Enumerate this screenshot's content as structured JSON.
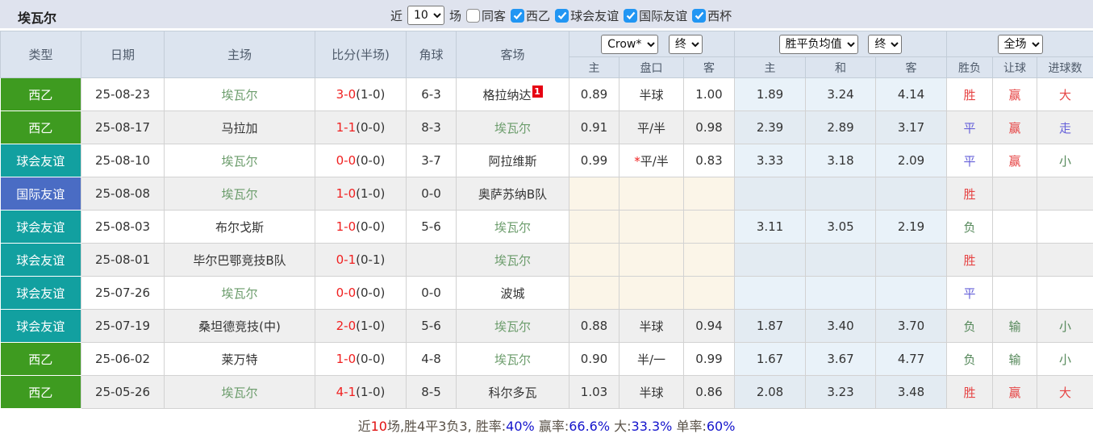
{
  "topbar": {
    "title": "埃瓦尔",
    "near_label": "近",
    "matches_select": {
      "value": "10"
    },
    "field_label": "场",
    "filters": [
      {
        "label": "同客",
        "checked": false
      },
      {
        "label": "西乙",
        "checked": true
      },
      {
        "label": "球会友谊",
        "checked": true
      },
      {
        "label": "国际友谊",
        "checked": true
      },
      {
        "label": "西杯",
        "checked": true
      }
    ]
  },
  "header": {
    "left_columns": [
      "类型",
      "日期",
      "主场",
      "比分(半场)",
      "角球",
      "客场"
    ],
    "dropdowns": {
      "bookmaker": "Crow*",
      "bookmaker_time": "终",
      "avg": "胜平负均值",
      "avg_time": "终",
      "scope": "全场"
    },
    "sub_columns": [
      "主",
      "盘口",
      "客",
      "主",
      "和",
      "客",
      "胜负",
      "让球",
      "进球数"
    ]
  },
  "colors": {
    "type": {
      "xiyi": "#3e9b20",
      "qiuhui": "#12a0a0",
      "guoji": "#4a6cc4"
    },
    "accent_checkbox": "#2196f3"
  },
  "rows": [
    {
      "type": "西乙",
      "type_key": "xiyi",
      "date": "25-08-23",
      "home": "埃瓦尔",
      "home_focus": true,
      "score": "3-0",
      "half": "(1-0)",
      "corner": "6-3",
      "away": "格拉纳达",
      "away_focus": false,
      "away_sup": "1",
      "crow_home": "0.89",
      "handicap_prefix": "",
      "handicap": "半球",
      "crow_away": "1.00",
      "avg_home": "1.89",
      "avg_draw": "3.24",
      "avg_away": "4.14",
      "result": "胜",
      "result_key": "red",
      "let_result": "赢",
      "let_key": "red",
      "goal_result": "大",
      "goal_key": "red"
    },
    {
      "type": "西乙",
      "type_key": "xiyi",
      "date": "25-08-17",
      "home": "马拉加",
      "home_focus": false,
      "score": "1-1",
      "half": "(0-0)",
      "corner": "8-3",
      "away": "埃瓦尔",
      "away_focus": true,
      "away_sup": "",
      "crow_home": "0.91",
      "handicap_prefix": "",
      "handicap": "平/半",
      "crow_away": "0.98",
      "avg_home": "2.39",
      "avg_draw": "2.89",
      "avg_away": "3.17",
      "result": "平",
      "result_key": "blue",
      "let_result": "赢",
      "let_key": "red",
      "goal_result": "走",
      "goal_key": "blue"
    },
    {
      "type": "球会友谊",
      "type_key": "qiuhui",
      "date": "25-08-10",
      "home": "埃瓦尔",
      "home_focus": true,
      "score": "0-0",
      "half": "(0-0)",
      "corner": "3-7",
      "away": "阿拉维斯",
      "away_focus": false,
      "away_sup": "",
      "crow_home": "0.99",
      "handicap_prefix": "*",
      "handicap": "平/半",
      "crow_away": "0.83",
      "avg_home": "3.33",
      "avg_draw": "3.18",
      "avg_away": "2.09",
      "result": "平",
      "result_key": "blue",
      "let_result": "赢",
      "let_key": "red",
      "goal_result": "小",
      "goal_key": "green"
    },
    {
      "type": "国际友谊",
      "type_key": "guoji",
      "date": "25-08-08",
      "home": "埃瓦尔",
      "home_focus": true,
      "score": "1-0",
      "half": "(1-0)",
      "corner": "0-0",
      "away": "奥萨苏纳B队",
      "away_focus": false,
      "away_sup": "",
      "crow_home": "",
      "handicap_prefix": "",
      "handicap": "",
      "crow_away": "",
      "avg_home": "",
      "avg_draw": "",
      "avg_away": "",
      "result": "胜",
      "result_key": "red",
      "let_result": "",
      "let_key": "",
      "goal_result": "",
      "goal_key": ""
    },
    {
      "type": "球会友谊",
      "type_key": "qiuhui",
      "date": "25-08-03",
      "home": "布尔戈斯",
      "home_focus": false,
      "score": "1-0",
      "half": "(0-0)",
      "corner": "5-6",
      "away": "埃瓦尔",
      "away_focus": true,
      "away_sup": "",
      "crow_home": "",
      "handicap_prefix": "",
      "handicap": "",
      "crow_away": "",
      "avg_home": "3.11",
      "avg_draw": "3.05",
      "avg_away": "2.19",
      "result": "负",
      "result_key": "green",
      "let_result": "",
      "let_key": "",
      "goal_result": "",
      "goal_key": ""
    },
    {
      "type": "球会友谊",
      "type_key": "qiuhui",
      "date": "25-08-01",
      "home": "毕尔巴鄂竞技B队",
      "home_focus": false,
      "score": "0-1",
      "half": "(0-1)",
      "corner": "",
      "away": "埃瓦尔",
      "away_focus": true,
      "away_sup": "",
      "crow_home": "",
      "handicap_prefix": "",
      "handicap": "",
      "crow_away": "",
      "avg_home": "",
      "avg_draw": "",
      "avg_away": "",
      "result": "胜",
      "result_key": "red",
      "let_result": "",
      "let_key": "",
      "goal_result": "",
      "goal_key": ""
    },
    {
      "type": "球会友谊",
      "type_key": "qiuhui",
      "date": "25-07-26",
      "home": "埃瓦尔",
      "home_focus": true,
      "score": "0-0",
      "half": "(0-0)",
      "corner": "0-0",
      "away": "波城",
      "away_focus": false,
      "away_sup": "",
      "crow_home": "",
      "handicap_prefix": "",
      "handicap": "",
      "crow_away": "",
      "avg_home": "",
      "avg_draw": "",
      "avg_away": "",
      "result": "平",
      "result_key": "blue",
      "let_result": "",
      "let_key": "",
      "goal_result": "",
      "goal_key": ""
    },
    {
      "type": "球会友谊",
      "type_key": "qiuhui",
      "date": "25-07-19",
      "home": "桑坦德竞技(中)",
      "home_focus": false,
      "score": "2-0",
      "half": "(1-0)",
      "corner": "5-6",
      "away": "埃瓦尔",
      "away_focus": true,
      "away_sup": "",
      "crow_home": "0.88",
      "handicap_prefix": "",
      "handicap": "半球",
      "crow_away": "0.94",
      "avg_home": "1.87",
      "avg_draw": "3.40",
      "avg_away": "3.70",
      "result": "负",
      "result_key": "green",
      "let_result": "输",
      "let_key": "green",
      "goal_result": "小",
      "goal_key": "green"
    },
    {
      "type": "西乙",
      "type_key": "xiyi",
      "date": "25-06-02",
      "home": "莱万特",
      "home_focus": false,
      "score": "1-0",
      "half": "(0-0)",
      "corner": "4-8",
      "away": "埃瓦尔",
      "away_focus": true,
      "away_sup": "",
      "crow_home": "0.90",
      "handicap_prefix": "",
      "handicap": "半/一",
      "crow_away": "0.99",
      "avg_home": "1.67",
      "avg_draw": "3.67",
      "avg_away": "4.77",
      "result": "负",
      "result_key": "green",
      "let_result": "输",
      "let_key": "green",
      "goal_result": "小",
      "goal_key": "green"
    },
    {
      "type": "西乙",
      "type_key": "xiyi",
      "date": "25-05-26",
      "home": "埃瓦尔",
      "home_focus": true,
      "score": "4-1",
      "half": "(1-0)",
      "corner": "8-5",
      "away": "科尔多瓦",
      "away_focus": false,
      "away_sup": "",
      "crow_home": "1.03",
      "handicap_prefix": "",
      "handicap": "半球",
      "crow_away": "0.86",
      "avg_home": "2.08",
      "avg_draw": "3.23",
      "avg_away": "3.48",
      "result": "胜",
      "result_key": "red",
      "let_result": "赢",
      "let_key": "red",
      "goal_result": "大",
      "goal_key": "red"
    }
  ],
  "footer": {
    "segments": [
      {
        "text": "近",
        "color": "dark"
      },
      {
        "text": "10",
        "color": "red"
      },
      {
        "text": "场,胜4平3负3, 胜率:",
        "color": "dark"
      },
      {
        "text": "40%",
        "color": "blue"
      },
      {
        "text": " 赢率:",
        "color": "dark"
      },
      {
        "text": "66.6%",
        "color": "blue"
      },
      {
        "text": " 大:",
        "color": "dark"
      },
      {
        "text": "33.3%",
        "color": "blue"
      },
      {
        "text": " 单率:",
        "color": "dark"
      },
      {
        "text": "60%",
        "color": "blue"
      }
    ]
  }
}
